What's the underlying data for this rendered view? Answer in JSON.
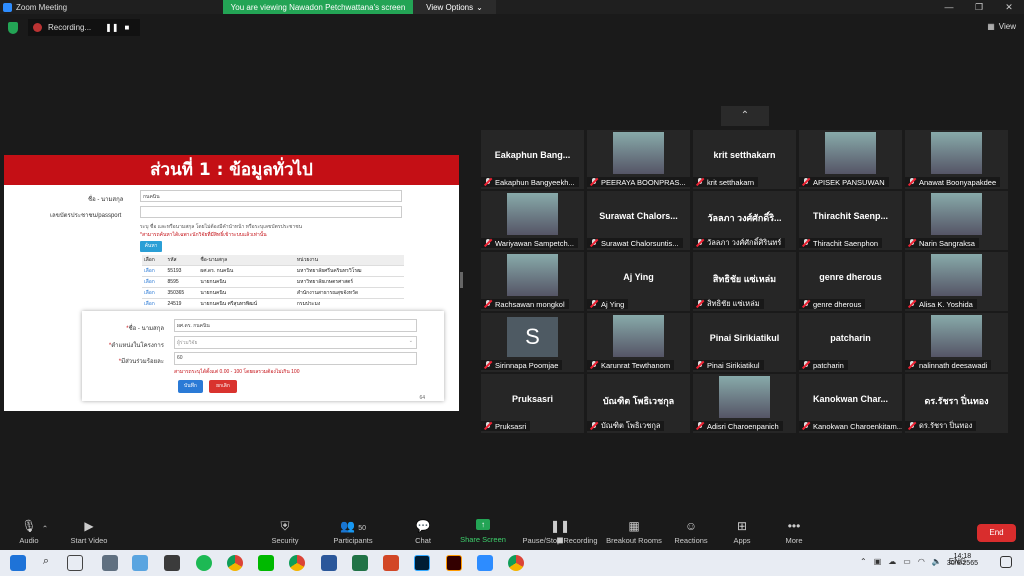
{
  "window": {
    "title": "Zoom Meeting"
  },
  "banner": {
    "message": "You are viewing Nawadon Petchwattana's screen",
    "view_options": "View Options"
  },
  "recording": {
    "label": "Recording..."
  },
  "topbar": {
    "view_label": "View"
  },
  "shared": {
    "header": "ส่วนที่ 1 : ข้อมูลทั่วไป",
    "name_label": "ชื่อ - นามสกุล",
    "name_value": "กนคนิน",
    "id_label": "เลขบัตรประชาชน/passport",
    "hint": "ระบุ ชื่อ และหรือนามสกุล โดยไม่ต้องมีคำนำหน้า หรือระบุเลขบัตรประชาชน",
    "red_hint": "*สามารถค้นหาได้เฉพาะนักวิจัยที่มีสิทธิ์เข้าระบบแล้วเท่านั้น",
    "search_btn": "ค้นหา",
    "table_headers": [
      "เลือก",
      "รหัส",
      "ชื่อ-นามสกุล",
      "หน่วยงาน"
    ],
    "rows": [
      {
        "select": "เลือก",
        "code": "55193",
        "name": "ผศ.ดร. กนคนิน",
        "org": "มหาวิทยาลัยศรีนครินทรวิโรฒ"
      },
      {
        "select": "เลือก",
        "code": "8595",
        "name": "นายกนคนิน",
        "org": "มหาวิทยาลัยเกษตรศาสตร์"
      },
      {
        "select": "เลือก",
        "code": "350365",
        "name": "นายกนคนิน",
        "org": "สำนักงานสาธารณสุขจังหวัด"
      },
      {
        "select": "เลือก",
        "code": "24519",
        "name": "นายกนคนิน ศรีสุนทรพิฒน์",
        "org": "กรมประมง"
      }
    ],
    "popup": {
      "name_label": "ชื่อ - นามสกุล",
      "name_value": "ผศ.ดร. กนคนิน",
      "role_label": "ตำแหน่งในโครงการ",
      "role_value": "ผู้ร่วมวิจัย",
      "pct_label": "มีส่วนร่วมร้อยละ",
      "pct_value": "60",
      "pct_note": "สามารถระบุได้ตั้งแต่ 0.00 - 100 โดยผลรวมต้องไม่เกิน 100",
      "save_btn": "บันทึก",
      "cancel_btn": "ยกเลิก"
    },
    "page_no": "64"
  },
  "gallery": {
    "up_icon": "chevron-up-icon",
    "tiles": [
      {
        "big": "Eakaphun  Bang...",
        "name": "Eakaphun Bangyeekh...",
        "photo": false
      },
      {
        "big": "",
        "name": "PEERAYA BOONPRAS...",
        "photo": true
      },
      {
        "big": "krit setthakarn",
        "name": "krit setthakarn",
        "photo": false
      },
      {
        "big": "",
        "name": "APISEK PANSUWAN",
        "photo": true
      },
      {
        "big": "",
        "name": "Anawat Boonyapakdee",
        "photo": true
      },
      {
        "big": "",
        "name": "Wariyawan Sampetch...",
        "photo": true
      },
      {
        "big": "Surawat  Chalors...",
        "name": "Surawat Chalorsuntis...",
        "photo": false
      },
      {
        "big": "วัลลภา วงศ์ศักดิ์ริ...",
        "name": "วัลลภา วงศ์ศักดิ์ศิรินทร์",
        "photo": false
      },
      {
        "big": "Thirachit  Saenp...",
        "name": "Thirachit Saenphon",
        "photo": false
      },
      {
        "big": "",
        "name": "Narin Sangraksa",
        "photo": true
      },
      {
        "big": "",
        "name": "Rachsawan mongkol",
        "photo": true
      },
      {
        "big": "Aj Ying",
        "name": "Aj Ying",
        "photo": false
      },
      {
        "big": "สิทธิชัย แซ่เหล่ม",
        "name": "สิทธิชัย แซ่เหล่ม",
        "photo": false
      },
      {
        "big": "genre dherous",
        "name": "genre dherous",
        "photo": false
      },
      {
        "big": "",
        "name": "Alisa K. Yoshida",
        "photo": true
      },
      {
        "big": "",
        "name": "Sirinnapa Poomjae",
        "photo": false,
        "initial": "S"
      },
      {
        "big": "",
        "name": "Karunrat Tewthanom",
        "photo": true
      },
      {
        "big": "Pinai Sirikiatikul",
        "name": "Pinai Sirikiatikul",
        "photo": false
      },
      {
        "big": "patcharin",
        "name": "patcharin",
        "photo": false
      },
      {
        "big": "",
        "name": "nalinnath deesawadi",
        "photo": true
      },
      {
        "big": "Pruksasri",
        "name": "Pruksasri",
        "photo": false
      },
      {
        "big": "บัณฑิต โพธิเวชกุล",
        "name": "บัณฑิต โพธิเวชกุล",
        "photo": false
      },
      {
        "big": "",
        "name": "Adisri Charoenpanich",
        "photo": true
      },
      {
        "big": "Kanokwan  Char...",
        "name": "Kanokwan Charoenkitam...",
        "photo": false
      },
      {
        "big": "ดร.รัชรา ปิ่นทอง",
        "name": "ดร.รัชรา ปิ่นทอง",
        "photo": false
      }
    ]
  },
  "toolbar": {
    "audio": "Audio",
    "video": "Start Video",
    "security": "Security",
    "participants": "Participants",
    "participants_count": "50",
    "chat": "Chat",
    "share": "Share Screen",
    "pause": "Pause/Stop Recording",
    "breakout": "Breakout Rooms",
    "reactions": "Reactions",
    "apps": "Apps",
    "more": "More",
    "end": "End"
  },
  "taskbar": {
    "lang": "ENG",
    "time": "14:18",
    "date": "30/6/2565",
    "apps": [
      "start",
      "search",
      "task-view",
      "calculator",
      "files",
      "game",
      "spotify",
      "chrome",
      "line",
      "chrome",
      "word",
      "excel",
      "powerpoint",
      "photoshop",
      "illustrator",
      "zoom",
      "chrome"
    ]
  },
  "colors": {
    "accent_green": "#23a455",
    "end_red": "#d92d2d",
    "header_red": "#c40f15"
  }
}
